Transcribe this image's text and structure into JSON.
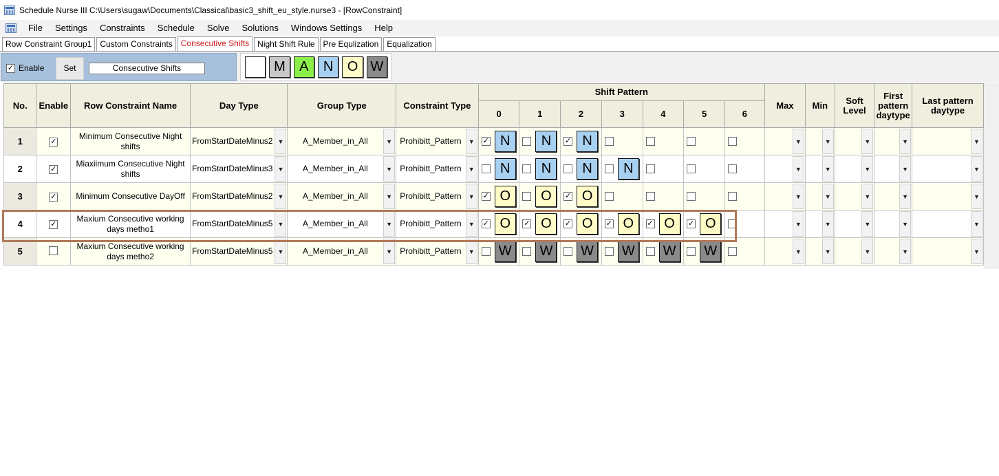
{
  "window": {
    "title": "Schedule Nurse III   C:\\Users\\sugaw\\Documents\\Classical\\basic3_shift_eu_style.nurse3 - [RowConstraint]"
  },
  "menu": [
    "File",
    "Settings",
    "Constraints",
    "Schedule",
    "Solve",
    "Solutions",
    "Windows Settings",
    "Help"
  ],
  "tabs": [
    {
      "label": "Row Constraint Group1",
      "active": false
    },
    {
      "label": "Custom Constraints",
      "active": false
    },
    {
      "label": "Consecutive Shifts",
      "active": true
    },
    {
      "label": "Night Shift Rule",
      "active": false
    },
    {
      "label": "Pre Equlization",
      "active": false
    },
    {
      "label": "Equalization",
      "active": false
    }
  ],
  "toolbar": {
    "enable_label": "Enable",
    "enable_checked": true,
    "set_label": "Set",
    "name_value": "Consecutive Shifts"
  },
  "palette": [
    "",
    "M",
    "A",
    "N",
    "O",
    "W"
  ],
  "colors": {
    "N": "#a8d0f0",
    "O": "#fffcc8",
    "W": "#8a8a8a",
    "A": "#8cf04a",
    "M": "#c8c8c8",
    "highlight": "#b07a5a",
    "toolbar_bg": "#a7c0db",
    "active_tab": "#d01818"
  },
  "grid": {
    "headers": {
      "no": "No.",
      "enable": "Enable",
      "name": "Row Constraint Name",
      "day_type": "Day Type",
      "group_type": "Group Type",
      "constraint_type": "Constraint Type",
      "shift_pattern": "Shift Pattern",
      "pattern_cols": [
        "0",
        "1",
        "2",
        "3",
        "4",
        "5",
        "6"
      ],
      "max": "Max",
      "min": "Min",
      "soft_level": "Soft Level",
      "first_pattern": "First pattern daytype",
      "last_pattern": "Last pattern daytype"
    },
    "rows": [
      {
        "no": "1",
        "enabled": true,
        "name": "Minimum Consecutive Night shifts",
        "day_type": "FromStartDateMinus2",
        "group_type": "A_Member_in_All",
        "constraint_type": "Prohibitt_Pattern",
        "pattern": [
          {
            "checked": true,
            "shift": "N"
          },
          {
            "checked": false,
            "shift": "N"
          },
          {
            "checked": true,
            "shift": "N"
          },
          {
            "checked": false,
            "shift": ""
          },
          {
            "checked": false,
            "shift": ""
          },
          {
            "checked": false,
            "shift": ""
          },
          {
            "checked": false,
            "shift": ""
          }
        ]
      },
      {
        "no": "2",
        "enabled": true,
        "name": "Miaxiimum Consecutive Night shifts",
        "day_type": "FromStartDateMinus3",
        "group_type": "A_Member_in_All",
        "constraint_type": "Prohibitt_Pattern",
        "pattern": [
          {
            "checked": false,
            "shift": "N"
          },
          {
            "checked": false,
            "shift": "N"
          },
          {
            "checked": false,
            "shift": "N"
          },
          {
            "checked": false,
            "shift": "N"
          },
          {
            "checked": false,
            "shift": ""
          },
          {
            "checked": false,
            "shift": ""
          },
          {
            "checked": false,
            "shift": ""
          }
        ]
      },
      {
        "no": "3",
        "enabled": true,
        "name": "Minimum Consecutive DayOff",
        "day_type": "FromStartDateMinus2",
        "group_type": "A_Member_in_All",
        "constraint_type": "Prohibitt_Pattern",
        "pattern": [
          {
            "checked": true,
            "shift": "O"
          },
          {
            "checked": false,
            "shift": "O"
          },
          {
            "checked": true,
            "shift": "O"
          },
          {
            "checked": false,
            "shift": ""
          },
          {
            "checked": false,
            "shift": ""
          },
          {
            "checked": false,
            "shift": ""
          },
          {
            "checked": false,
            "shift": ""
          }
        ]
      },
      {
        "no": "4",
        "enabled": true,
        "name": "Maxium Consecutive working days metho1",
        "day_type": "FromStartDateMinus5",
        "group_type": "A_Member_in_All",
        "constraint_type": "Prohibitt_Pattern",
        "pattern": [
          {
            "checked": true,
            "shift": "O"
          },
          {
            "checked": true,
            "shift": "O"
          },
          {
            "checked": true,
            "shift": "O"
          },
          {
            "checked": true,
            "shift": "O"
          },
          {
            "checked": true,
            "shift": "O"
          },
          {
            "checked": true,
            "shift": "O"
          },
          {
            "checked": false,
            "shift": ""
          }
        ]
      },
      {
        "no": "5",
        "enabled": false,
        "name": "Maxium Consecutive working days metho2",
        "day_type": "FromStartDateMinus5",
        "group_type": "A_Member_in_All",
        "constraint_type": "Prohibitt_Pattern",
        "pattern": [
          {
            "checked": false,
            "shift": "W"
          },
          {
            "checked": false,
            "shift": "W"
          },
          {
            "checked": false,
            "shift": "W"
          },
          {
            "checked": false,
            "shift": "W"
          },
          {
            "checked": false,
            "shift": "W"
          },
          {
            "checked": false,
            "shift": "W"
          },
          {
            "checked": false,
            "shift": ""
          }
        ]
      }
    ]
  }
}
